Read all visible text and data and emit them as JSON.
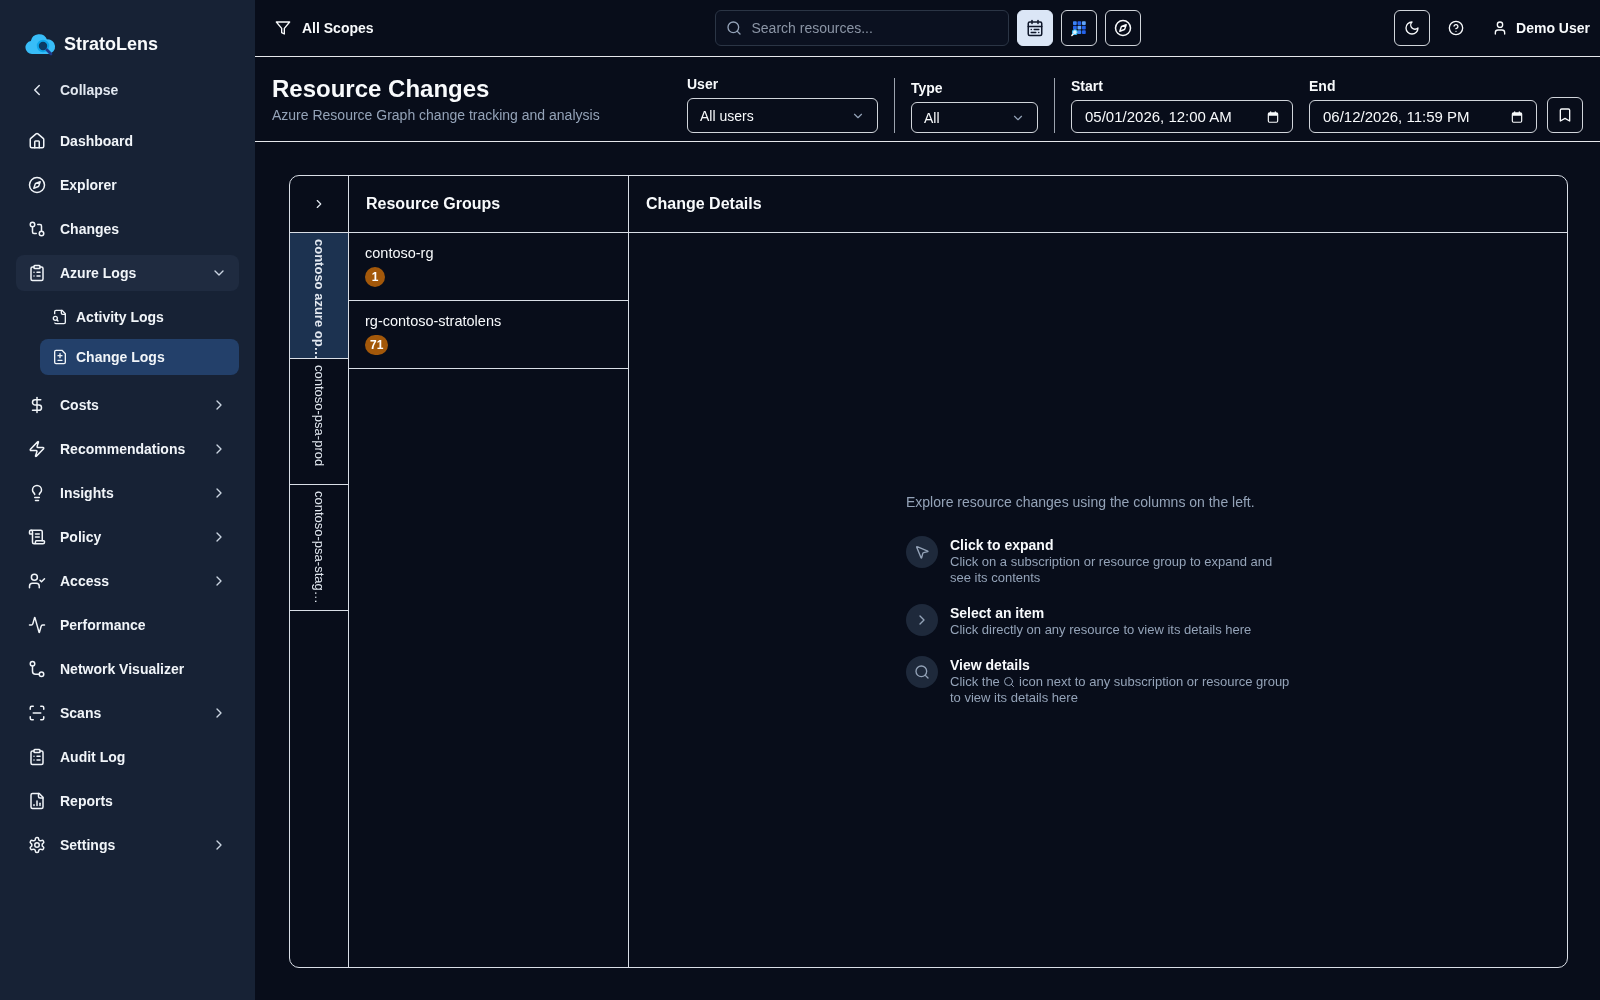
{
  "sidebar": {
    "brand": "StratoLens",
    "collapse": "Collapse",
    "items": [
      {
        "label": "Dashboard",
        "kind": "link",
        "selected": false
      },
      {
        "label": "Explorer",
        "kind": "link",
        "selected": false
      },
      {
        "label": "Changes",
        "kind": "link",
        "selected": false
      },
      {
        "label": "Azure Logs",
        "kind": "group",
        "selected": false,
        "expanded": true,
        "children": [
          {
            "label": "Activity Logs",
            "selected": false
          },
          {
            "label": "Change Logs",
            "selected": true
          }
        ]
      },
      {
        "label": "Costs",
        "kind": "group",
        "selected": false,
        "expanded": false
      },
      {
        "label": "Recommendations",
        "kind": "group",
        "selected": false,
        "expanded": false
      },
      {
        "label": "Insights",
        "kind": "group",
        "selected": false,
        "expanded": false
      },
      {
        "label": "Policy",
        "kind": "group",
        "selected": false,
        "expanded": false
      },
      {
        "label": "Access",
        "kind": "group",
        "selected": false,
        "expanded": false
      },
      {
        "label": "Performance",
        "kind": "link",
        "selected": false
      },
      {
        "label": "Network Visualizer",
        "kind": "link",
        "selected": false
      },
      {
        "label": "Scans",
        "kind": "group",
        "selected": false,
        "expanded": false
      },
      {
        "label": "Audit Log",
        "kind": "link",
        "selected": false
      },
      {
        "label": "Reports",
        "kind": "link",
        "selected": false
      },
      {
        "label": "Settings",
        "kind": "group",
        "selected": false,
        "expanded": false
      }
    ]
  },
  "top_bar": {
    "scope": "All Scopes",
    "search": {
      "placeholder": "Search resources..."
    },
    "view_buttons": [
      {
        "selected": true
      },
      {
        "selected": false
      },
      {
        "selected": false
      }
    ],
    "user": "Demo User"
  },
  "header": {
    "title": "Resource Changes",
    "subtitle": "Azure Resource Graph change tracking and analysis",
    "filters": [
      {
        "kind": "select",
        "label": "User",
        "value": "All users"
      },
      {
        "kind": "select",
        "label": "Type",
        "value": "All"
      },
      {
        "kind": "datetime",
        "label": "Start",
        "value": "05/01/2026, 12:00 AM"
      },
      {
        "kind": "datetime",
        "label": "End",
        "value": "06/12/2026, 11:59 PM"
      }
    ]
  },
  "explorer": {
    "subscriptions": [
      {
        "name": "contoso azure op…",
        "selected": true
      },
      {
        "name": "contoso-psa-prod",
        "selected": false
      },
      {
        "name": "contoso-psa-stag…",
        "selected": false
      }
    ],
    "resource_groups": {
      "title": "Resource Groups",
      "items": [
        {
          "name": "contoso-rg",
          "count": "1",
          "selected": false
        },
        {
          "name": "rg-contoso-stratolens",
          "count": "71",
          "selected": false
        }
      ]
    },
    "details": {
      "title": "Change Details",
      "intro": "Explore resource changes using the columns on the left.",
      "tips": [
        {
          "title": "Click to expand",
          "text": "Click on a subscription or resource group to expand and see its contents"
        },
        {
          "title": "Select an item",
          "text": "Click directly on any resource to view its details here"
        },
        {
          "title": "View details",
          "text": "Click the",
          "text_after": "icon next to any subscription or resource group to view its details here"
        }
      ]
    }
  }
}
